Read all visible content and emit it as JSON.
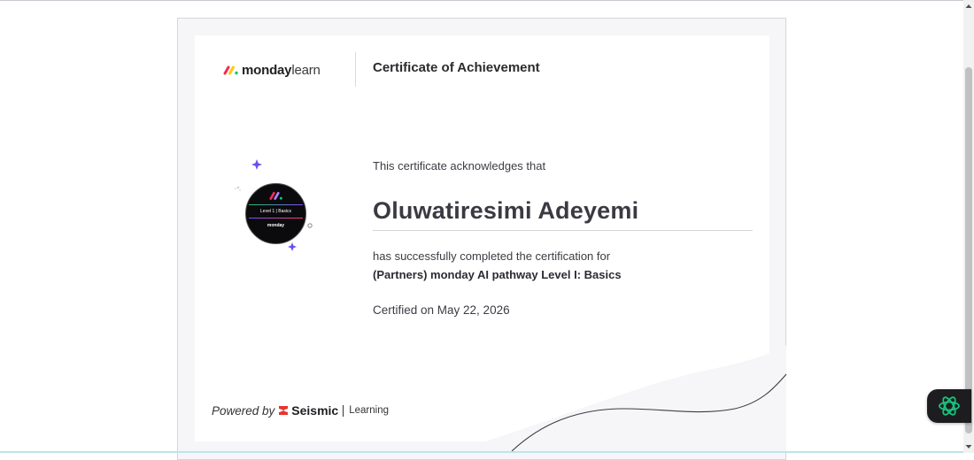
{
  "certificate": {
    "brand_bold": "monday",
    "brand_light": "learn",
    "title": "Certificate of Achievement",
    "acknowledgement": "This certificate acknowledges that",
    "recipient_name": "Oluwatiresimi Adeyemi",
    "completion_text": "has successfully completed the certification for",
    "course_name": "(Partners) monday AI pathway Level I: Basics",
    "certified_on": "Certified on May 22, 2026"
  },
  "badge": {
    "level_text": "Level 1 | Basics",
    "brand_text": "monday",
    "icon": "monday-logo-icon"
  },
  "footer": {
    "powered_by": "Powered by",
    "provider": "Seismic",
    "provider_sub": "Learning",
    "icon": "seismic-logo-icon"
  },
  "colors": {
    "sparkle": "#6b4df0",
    "monday_red": "#f62b54",
    "monday_yellow": "#ffcc00",
    "monday_green": "#00ca72",
    "seismic_red": "#e8322f",
    "assistant_green": "#19c37d"
  },
  "assistant": {
    "icon": "ai-assistant-icon"
  }
}
